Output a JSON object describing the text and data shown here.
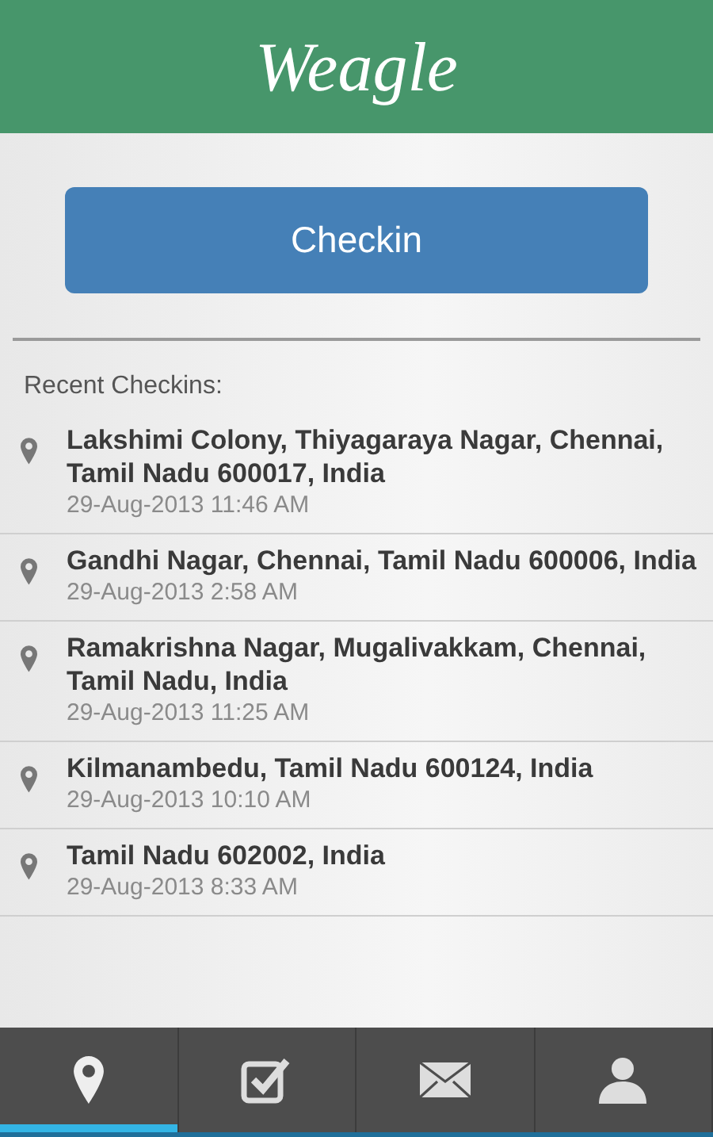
{
  "header": {
    "logo": "Weagle"
  },
  "checkin_button": "Checkin",
  "recent_heading": "Recent Checkins:",
  "checkins": [
    {
      "address": "Lakshimi Colony, Thiyagaraya Nagar, Chennai, Tamil Nadu 600017, India",
      "time": "29-Aug-2013 11:46 AM"
    },
    {
      "address": "Gandhi Nagar, Chennai, Tamil Nadu 600006, India",
      "time": "29-Aug-2013 2:58 AM"
    },
    {
      "address": "Ramakrishna Nagar, Mugalivakkam, Chennai, Tamil Nadu, India",
      "time": "29-Aug-2013 11:25 AM"
    },
    {
      "address": "Kilmanambedu, Tamil Nadu 600124, India",
      "time": "29-Aug-2013 10:10 AM"
    },
    {
      "address": "Tamil Nadu 602002, India",
      "time": "29-Aug-2013 8:33 AM"
    }
  ],
  "tabs": [
    {
      "kind": "pin",
      "selected": true
    },
    {
      "kind": "check",
      "selected": false
    },
    {
      "kind": "mail",
      "selected": false
    },
    {
      "kind": "person",
      "selected": false
    }
  ]
}
